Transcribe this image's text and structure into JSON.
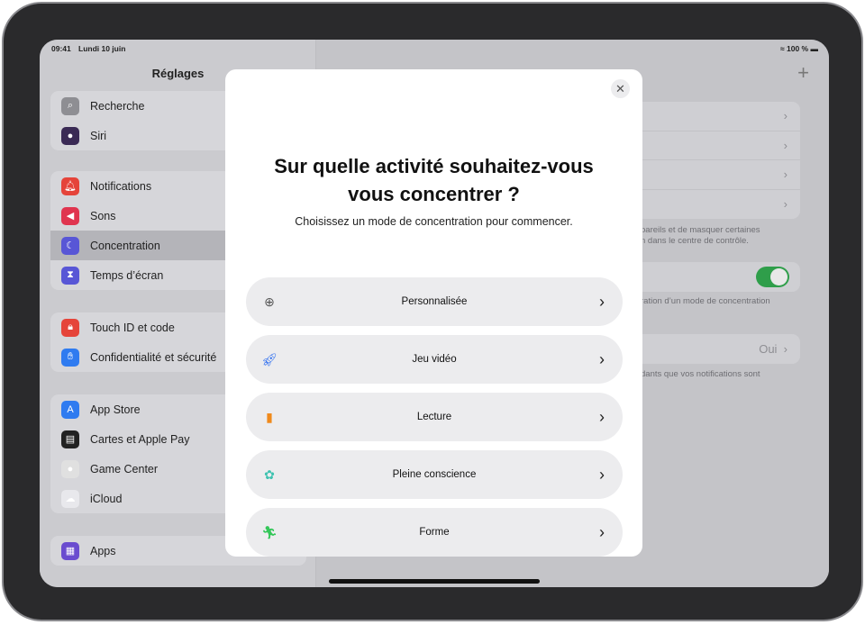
{
  "status": {
    "time": "09:41",
    "date": "Lundi 10 juin",
    "battery": "100 %"
  },
  "sidebar": {
    "title": "Réglages",
    "groups": [
      [
        {
          "label": "Recherche",
          "icon": "search-icon",
          "color": "#8e8e93"
        },
        {
          "label": "Siri",
          "icon": "siri-icon",
          "color": "#3a2a55"
        }
      ],
      [
        {
          "label": "Notifications",
          "icon": "bell-icon",
          "color": "#e5443a"
        },
        {
          "label": "Sons",
          "icon": "speaker-icon",
          "color": "#e0344f"
        },
        {
          "label": "Concentration",
          "icon": "moon-icon",
          "color": "#5856d6",
          "selected": true
        },
        {
          "label": "Temps d’écran",
          "icon": "hourglass-icon",
          "color": "#5856d6"
        }
      ],
      [
        {
          "label": "Touch ID et code",
          "icon": "lock-icon",
          "color": "#e5443a"
        },
        {
          "label": "Confidentialité et sécurité",
          "icon": "hand-icon",
          "color": "#2f7bf0"
        }
      ],
      [
        {
          "label": "App Store",
          "icon": "app-store-icon",
          "color": "#2f7bf0"
        },
        {
          "label": "Cartes et Apple Pay",
          "icon": "wallet-icon",
          "color": "#222"
        },
        {
          "label": "Game Center",
          "icon": "game-center-icon",
          "color": "#e0e0e0"
        },
        {
          "label": "iCloud",
          "icon": "cloud-icon",
          "color": "#e8e8ec"
        }
      ],
      [
        {
          "label": "Apps",
          "icon": "apps-grid-icon",
          "color": "#6a4ccf"
        }
      ]
    ]
  },
  "detail": {
    "add_icon": "plus-icon",
    "footnote1_line1": "pareils et de masquer certaines",
    "footnote1_line2": "n dans le centre de contrôle.",
    "footnote2": "ration d’un mode de concentration",
    "toggle_on": true,
    "value": "Oui",
    "footnote3": "dants que vos notifications sont"
  },
  "modal": {
    "title_line1": "Sur quelle activité souhaitez-vous",
    "title_line2": "vous concentrer ?",
    "subtitle": "Choisissez un mode de concentration pour commencer.",
    "options": [
      {
        "label": "Personnalisée",
        "icon": "plus-circle-icon",
        "color": "#555"
      },
      {
        "label": "Jeu vidéo",
        "icon": "rocket-icon",
        "color": "#2f6ff0"
      },
      {
        "label": "Lecture",
        "icon": "book-icon",
        "color": "#f08a1c"
      },
      {
        "label": "Pleine conscience",
        "icon": "flower-icon",
        "color": "#3ec2b0"
      },
      {
        "label": "Forme",
        "icon": "running-icon",
        "color": "#34c759"
      }
    ]
  }
}
